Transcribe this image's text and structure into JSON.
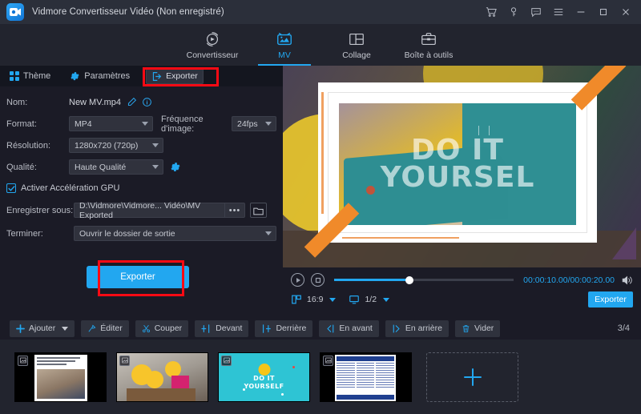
{
  "titlebar": {
    "app_title": "Vidmore Convertisseur Vidéo (Non enregistré)",
    "logo_name": "vidmore-logo",
    "window_buttons": [
      {
        "name": "cart-icon",
        "label": ""
      },
      {
        "name": "key-icon",
        "label": ""
      },
      {
        "name": "feedback-icon",
        "label": ""
      },
      {
        "name": "menu-icon",
        "label": ""
      },
      {
        "name": "minimize-icon",
        "label": ""
      },
      {
        "name": "maximize-icon",
        "label": ""
      },
      {
        "name": "close-icon",
        "label": ""
      }
    ]
  },
  "mainnav": {
    "items": [
      {
        "label": "Convertisseur",
        "icon": "converter-icon",
        "active": false
      },
      {
        "label": "MV",
        "icon": "mv-icon",
        "active": true
      },
      {
        "label": "Collage",
        "icon": "collage-icon",
        "active": false
      },
      {
        "label": "Boîte à outils",
        "icon": "toolbox-icon",
        "active": false
      }
    ]
  },
  "subtabs": {
    "theme": "Thème",
    "settings": "Paramètres",
    "export": "Exporter"
  },
  "settings": {
    "name_label": "Nom:",
    "name_value": "New MV.mp4",
    "format_label": "Format:",
    "format_value": "MP4",
    "framerate_label": "Fréquence d'image:",
    "framerate_value": "24fps",
    "resolution_label": "Résolution:",
    "resolution_value": "1280x720 (720p)",
    "quality_label": "Qualité:",
    "quality_value": "Haute Qualité",
    "gpu_label": "Activer Accélération GPU",
    "gpu_checked": true,
    "saveto_label": "Enregistrer sous:",
    "saveto_value": "D:\\Vidmore\\Vidmore... Vidéo\\MV Exported",
    "browse_dots": "•••",
    "finish_label": "Terminer:",
    "finish_value": "Ouvrir le dossier de sortie",
    "export_button": "Exporter"
  },
  "preview": {
    "overlay_line1": "DO IT",
    "overlay_line2": "YOURSEL"
  },
  "player": {
    "current_total_time": "00:00:10.00/00:00:20.00",
    "progress_percent": 42,
    "aspect_ratio": "16:9",
    "zoom_value": "1/2",
    "export_button": "Exporter",
    "play_icon": "play-icon",
    "stop_icon": "stop-icon",
    "volume_icon": "volume-icon"
  },
  "toolbar": {
    "buttons": [
      {
        "label": "Ajouter",
        "icon": "plus-icon",
        "dropdown": true
      },
      {
        "label": "Éditer",
        "icon": "edit-icon",
        "dropdown": false
      },
      {
        "label": "Couper",
        "icon": "scissors-icon",
        "dropdown": false
      },
      {
        "label": "Devant",
        "icon": "insert-before-icon",
        "dropdown": false
      },
      {
        "label": "Derrière",
        "icon": "insert-after-icon",
        "dropdown": false
      },
      {
        "label": "En avant",
        "icon": "move-forward-icon",
        "dropdown": false
      },
      {
        "label": "En arrière",
        "icon": "move-backward-icon",
        "dropdown": false
      },
      {
        "label": "Vider",
        "icon": "trash-icon",
        "dropdown": false
      }
    ],
    "page_count": "3/4"
  },
  "storyboard": {
    "clips": [
      {
        "name": "clip-1",
        "caption": "La source de chaleur ci se trouve même à quel endroit t seulement ?"
      },
      {
        "name": "clip-2",
        "caption": ""
      },
      {
        "name": "clip-3",
        "caption": "DO IT\nYOURSELF"
      },
      {
        "name": "clip-4",
        "caption": ""
      }
    ],
    "add_tile_label": "+"
  },
  "colors": {
    "accent": "#22a7f0",
    "highlight": "#fa0a14",
    "window_bg": "#1b1b26",
    "titlebar_bg": "#2b2f3a",
    "nav_bg": "#22242e"
  }
}
